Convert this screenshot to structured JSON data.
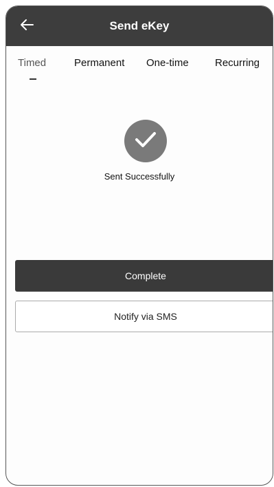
{
  "header": {
    "title": "Send eKey",
    "back_icon": "arrow-left-icon",
    "background": "#3d3d3d"
  },
  "tabs": [
    {
      "label": "Timed",
      "active": true
    },
    {
      "label": "Permanent",
      "active": false
    },
    {
      "label": "One-time",
      "active": false
    },
    {
      "label": "Recurring",
      "active": false
    }
  ],
  "status": {
    "icon": "checkmark-icon",
    "message": "Sent Successfully"
  },
  "actions": {
    "complete_label": "Complete",
    "sms_label": "Notify via SMS"
  }
}
